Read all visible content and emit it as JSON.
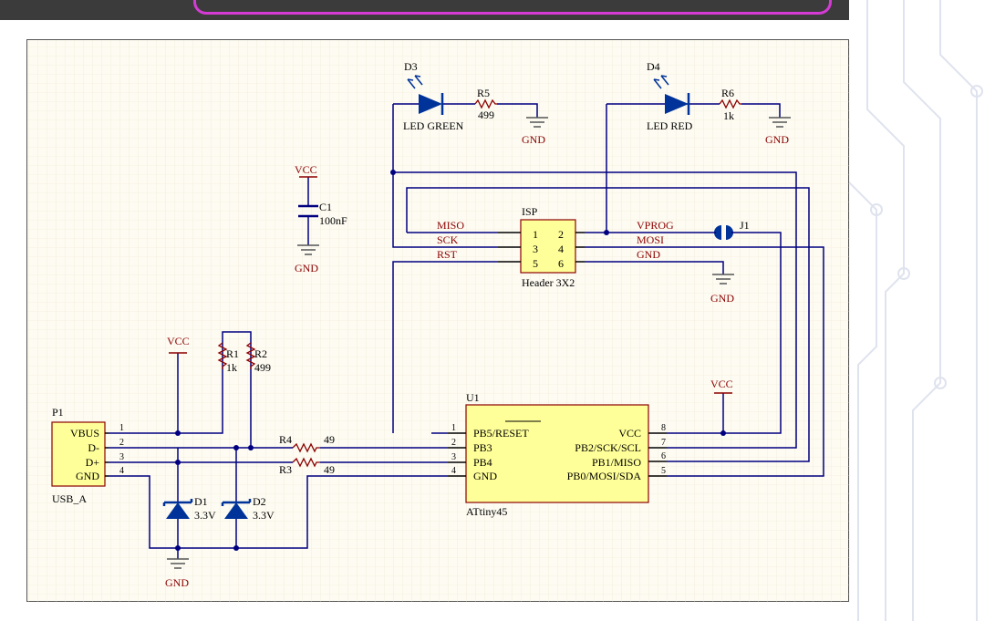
{
  "header": {
    "bar_color": "#3b3b3b",
    "accent": "#d43bd4"
  },
  "colors": {
    "wire": "#000080",
    "part_fill": "#ffff99",
    "part_border": "#8b0000",
    "net": "#8b0000",
    "diode": "#003399",
    "sheet": "#fdfbf2"
  },
  "components": {
    "d3": {
      "ref": "D3",
      "value": "LED GREEN"
    },
    "r5": {
      "ref": "R5",
      "value": "499"
    },
    "d4": {
      "ref": "D4",
      "value": "LED RED"
    },
    "r6": {
      "ref": "R6",
      "value": "1k"
    },
    "c1": {
      "ref": "C1",
      "value": "100nF"
    },
    "isp": {
      "ref": "ISP",
      "value": "Header 3X2",
      "pins": [
        "1",
        "2",
        "3",
        "4",
        "5",
        "6"
      ]
    },
    "j1": {
      "ref": "J1"
    },
    "r1": {
      "ref": "R1",
      "value": "1k"
    },
    "r2": {
      "ref": "R2",
      "value": "499"
    },
    "r3": {
      "ref": "R3",
      "value": "49"
    },
    "r4": {
      "ref": "R4",
      "value": "49"
    },
    "d1": {
      "ref": "D1",
      "value": "3.3V"
    },
    "d2": {
      "ref": "D2",
      "value": "3.3V"
    },
    "p1": {
      "ref": "P1",
      "value": "USB_A",
      "pins": [
        "VBUS",
        "D-",
        "D+",
        "GND"
      ],
      "pin_numbers": [
        "1",
        "2",
        "3",
        "4"
      ]
    },
    "u1": {
      "ref": "U1",
      "value": "ATtiny45",
      "left_pins": [
        "PB5/RESET",
        "PB3",
        "PB4",
        "GND"
      ],
      "left_numbers": [
        "1",
        "2",
        "3",
        "4"
      ],
      "right_pins": [
        "VCC",
        "PB2/SCK/SCL",
        "PB1/MISO",
        "PB0/MOSI/SDA"
      ],
      "right_numbers": [
        "8",
        "7",
        "6",
        "5"
      ]
    }
  },
  "nets": {
    "miso": "MISO",
    "sck": "SCK",
    "rst": "RST",
    "vprog": "VPROG",
    "mosi": "MOSI",
    "gnd": "GND"
  },
  "power": {
    "vcc": "VCC",
    "gnd": "GND"
  }
}
